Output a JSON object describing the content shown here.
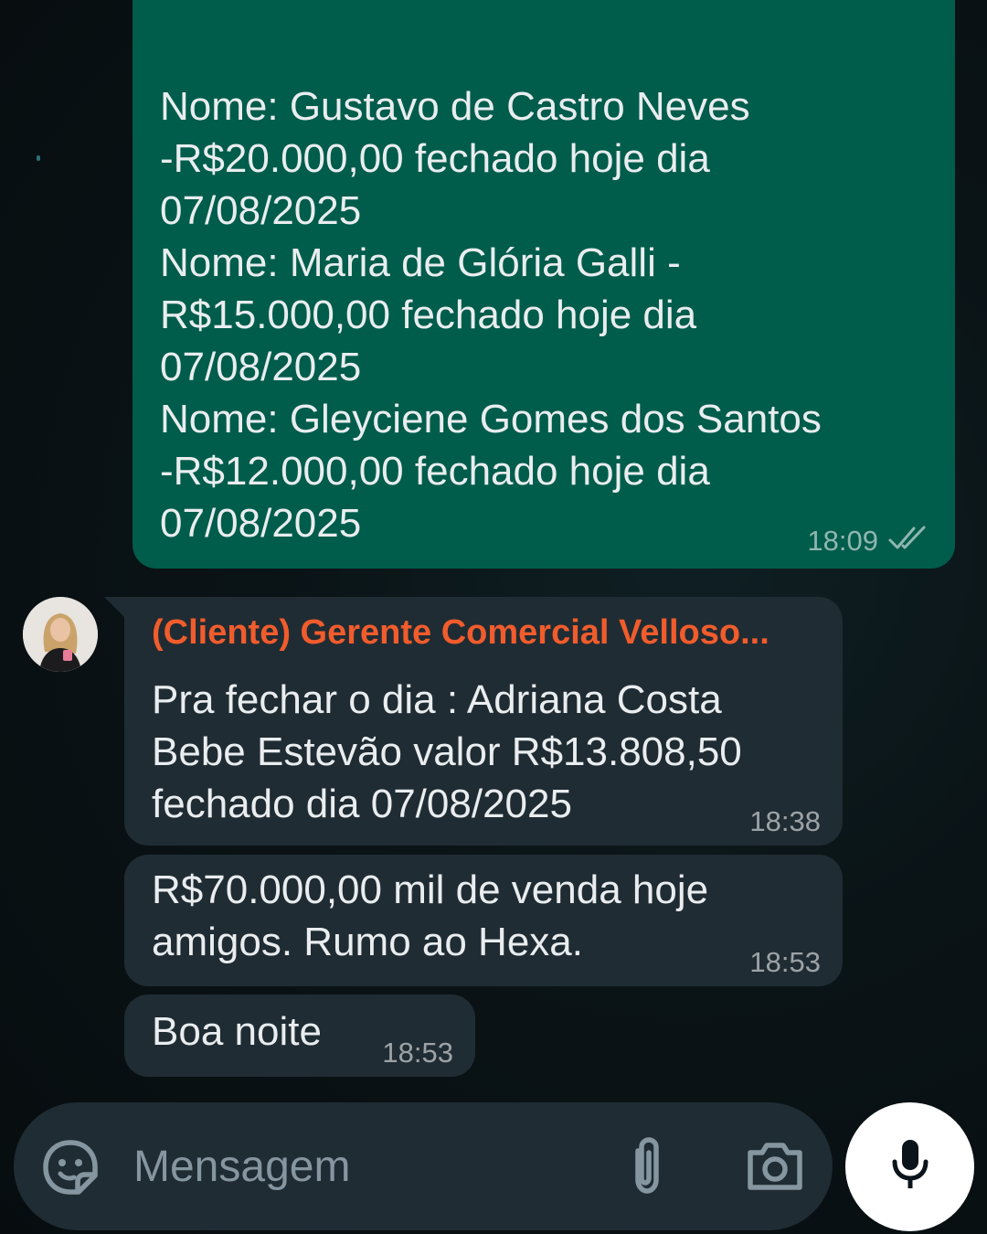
{
  "outgoing": {
    "lines": [
      "Nome: Gustavo de Castro Neves",
      "-R$20.000,00 fechado hoje dia",
      "07/08/2025",
      "Nome: Maria de Glória Galli -",
      "R$15.000,00 fechado hoje dia",
      "07/08/2025",
      "Nome: Gleyciene Gomes dos Santos",
      "-R$12.000,00 fechado hoje dia",
      "07/08/2025"
    ],
    "time": "18:09",
    "status_icon": "double-check-icon"
  },
  "incoming": [
    {
      "sender": "(Cliente) Gerente Comercial Velloso...",
      "lines": [
        "Pra fechar o dia : Adriana Costa",
        "Bebe Estevão valor R$13.808,50",
        "fechado dia 07/08/2025"
      ],
      "time": "18:38"
    },
    {
      "lines": [
        "R$70.000,00 mil de venda hoje",
        "amigos. Rumo ao Hexa."
      ],
      "time": "18:53"
    },
    {
      "lines": [
        "Boa noite"
      ],
      "time": "18:53"
    }
  ],
  "composer": {
    "placeholder": "Mensagem",
    "value": "",
    "icons": [
      "sticker-icon",
      "attach-icon",
      "camera-icon",
      "microphone-icon"
    ]
  },
  "colors": {
    "outgoing_bubble": "#005c4b",
    "incoming_bubble": "#202c33",
    "sender_name": "#f15c2c",
    "background": "#0b1417",
    "composer": "#1f2c33",
    "mic_button": "#ffffff"
  }
}
